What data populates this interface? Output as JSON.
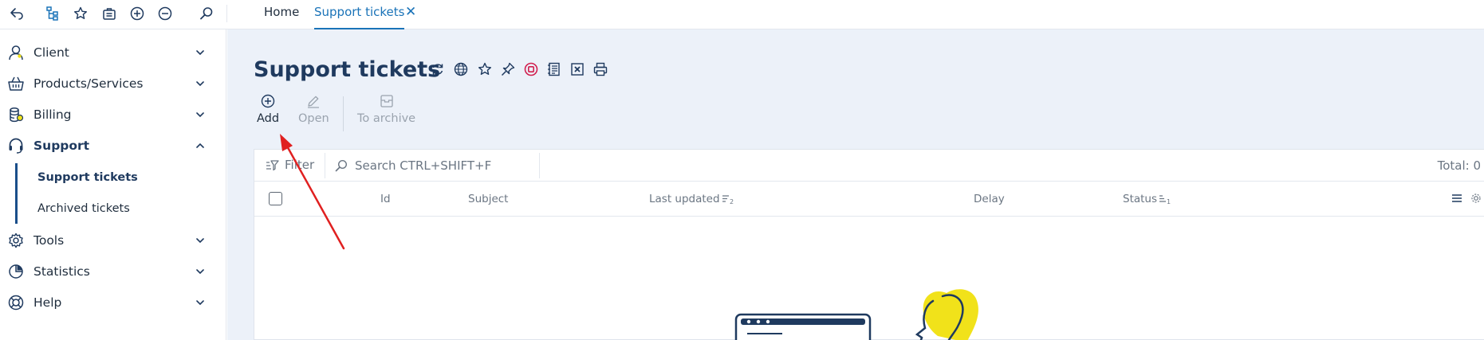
{
  "topbar": {
    "icons": [
      "back-icon",
      "sitemap-icon",
      "star-icon",
      "briefcase-icon",
      "plus-circle-icon",
      "minus-circle-icon",
      "search-icon"
    ],
    "tabs": [
      {
        "label": "Home",
        "active": false
      },
      {
        "label": "Support tickets",
        "active": true
      }
    ],
    "close_glyph": "✕"
  },
  "sidebar": {
    "items": [
      {
        "label": "Client",
        "icon": "client-icon",
        "expanded": false
      },
      {
        "label": "Products/Services",
        "icon": "basket-icon",
        "expanded": false
      },
      {
        "label": "Billing",
        "icon": "coins-icon",
        "expanded": false
      },
      {
        "label": "Support",
        "icon": "headset-icon",
        "expanded": true
      },
      {
        "label": "Tools",
        "icon": "gear-icon",
        "expanded": false
      },
      {
        "label": "Statistics",
        "icon": "pie-chart-icon",
        "expanded": false
      },
      {
        "label": "Help",
        "icon": "lifebuoy-icon",
        "expanded": false
      }
    ],
    "support_children": [
      {
        "label": "Support tickets",
        "active": true
      },
      {
        "label": "Archived tickets",
        "active": false
      }
    ]
  },
  "main": {
    "title": "Support tickets",
    "title_icons": [
      "refresh-icon",
      "globe-icon",
      "star-icon",
      "pin-icon",
      "stop-icon",
      "list-icon",
      "excel-icon",
      "print-icon"
    ],
    "actions": [
      {
        "label": "Add",
        "icon": "plus-circle-icon",
        "enabled": true
      },
      {
        "label": "Open",
        "icon": "pencil-icon",
        "enabled": false
      },
      {
        "label": "To archive",
        "icon": "archive-icon",
        "enabled": false
      }
    ],
    "filter_label": "Filter",
    "search_placeholder": "Search CTRL+SHIFT+F",
    "total_label": "Total: 0",
    "columns": [
      {
        "label": "Id"
      },
      {
        "label": "Subject"
      },
      {
        "label": "Last updated",
        "sort_order": "2"
      },
      {
        "label": "Delay"
      },
      {
        "label": "Status",
        "sort_order": "1"
      }
    ]
  },
  "colors": {
    "accent": "#1a73b8",
    "nav_dark": "#1f3a5f",
    "main_bg": "#ecf1f9",
    "arrow": "#e02020",
    "illustration_yellow": "#f1e21a"
  }
}
